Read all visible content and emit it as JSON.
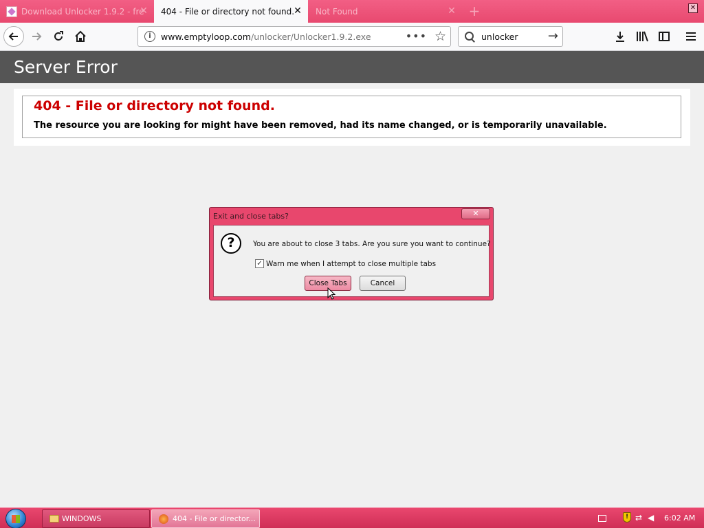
{
  "browser": {
    "tabs": [
      {
        "label": "Download Unlocker 1.9.2 - fre",
        "active": false
      },
      {
        "label": "404 - File or directory not found.",
        "active": true
      },
      {
        "label": "Not Found",
        "active": false
      }
    ],
    "url": {
      "host": "www.emptyloop.com",
      "path": "/unlocker/Unlocker1.9.2.exe"
    },
    "search": {
      "value": "unlocker"
    }
  },
  "page": {
    "header_title": "Server Error",
    "error_heading": "404 - File or directory not found.",
    "error_message": "The resource you are looking for might have been removed, had its name changed, or is temporarily unavailable."
  },
  "dialog": {
    "title": "Exit and close tabs?",
    "message": "You are about to close 3 tabs. Are you sure you want to continue?",
    "checkbox_label": "Warn me when I attempt to close multiple tabs",
    "checkbox_checked": true,
    "confirm_label": "Close Tabs",
    "cancel_label": "Cancel"
  },
  "taskbar": {
    "items": [
      {
        "label": "WINDOWS"
      },
      {
        "label": "404 - File or director..."
      }
    ],
    "clock": "6:02 AM"
  },
  "colors": {
    "accent": "#e8476d",
    "error_red": "#cc0000",
    "header_gray": "#555555"
  }
}
